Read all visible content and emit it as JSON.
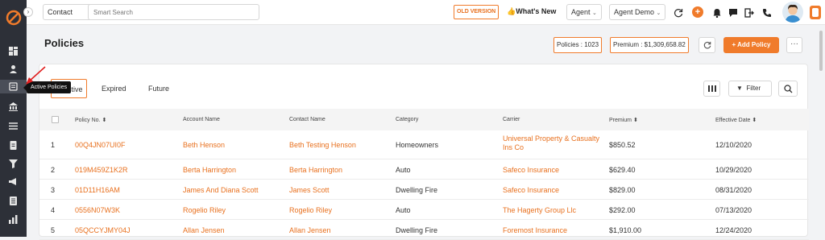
{
  "sidebar": {
    "tooltip": "Active Policies"
  },
  "topbar": {
    "contact_select": "Contact",
    "search_placeholder": "Smart Search",
    "old_version": "OLD VERSION",
    "whats_new": "What's New",
    "agent_select": "Agent",
    "agent_demo": "Agent Demo"
  },
  "header": {
    "title": "Policies",
    "policies_count": "Policies : 1023",
    "premium_total": "Premium : $1,309,658.82",
    "add_policy": "+ Add Policy",
    "more": "···"
  },
  "tabs": [
    "Active",
    "Expired",
    "Future"
  ],
  "filter_label": "Filter",
  "table": {
    "columns": [
      "Policy No.",
      "Account Name",
      "Contact Name",
      "Category",
      "Carrier",
      "Premium",
      "Effective Date"
    ],
    "rows": [
      {
        "index": "1",
        "policy_no": "00Q4JN07UI0F",
        "account": "Beth Henson",
        "contact": "Beth Testing Henson",
        "category": "Homeowners",
        "carrier": "Universal Property & Casualty Ins Co",
        "premium": "$850.52",
        "effective": "12/10/2020"
      },
      {
        "index": "2",
        "policy_no": "019M459Z1K2R",
        "account": "Berta Harrington",
        "contact": "Berta Harrington",
        "category": "Auto",
        "carrier": "Safeco Insurance",
        "premium": "$629.40",
        "effective": "10/29/2020"
      },
      {
        "index": "3",
        "policy_no": "01D11H16AM",
        "account": "James And Diana Scott",
        "contact": "James Scott",
        "category": "Dwelling Fire",
        "carrier": "Safeco Insurance",
        "premium": "$829.00",
        "effective": "08/31/2020"
      },
      {
        "index": "4",
        "policy_no": "0556N07W3K",
        "account": "Rogelio Riley",
        "contact": "Rogelio Riley",
        "category": "Auto",
        "carrier": "The Hagerty Group Llc",
        "premium": "$292.00",
        "effective": "07/13/2020"
      },
      {
        "index": "5",
        "policy_no": "05QCCYJMY04J",
        "account": "Allan Jensen",
        "contact": "Allan Jensen",
        "category": "Dwelling Fire",
        "carrier": "Foremost Insurance",
        "premium": "$1,910.00",
        "effective": "12/24/2020"
      }
    ]
  },
  "colors": {
    "accent": "#f07b2b",
    "sidebar": "#2d3038"
  }
}
